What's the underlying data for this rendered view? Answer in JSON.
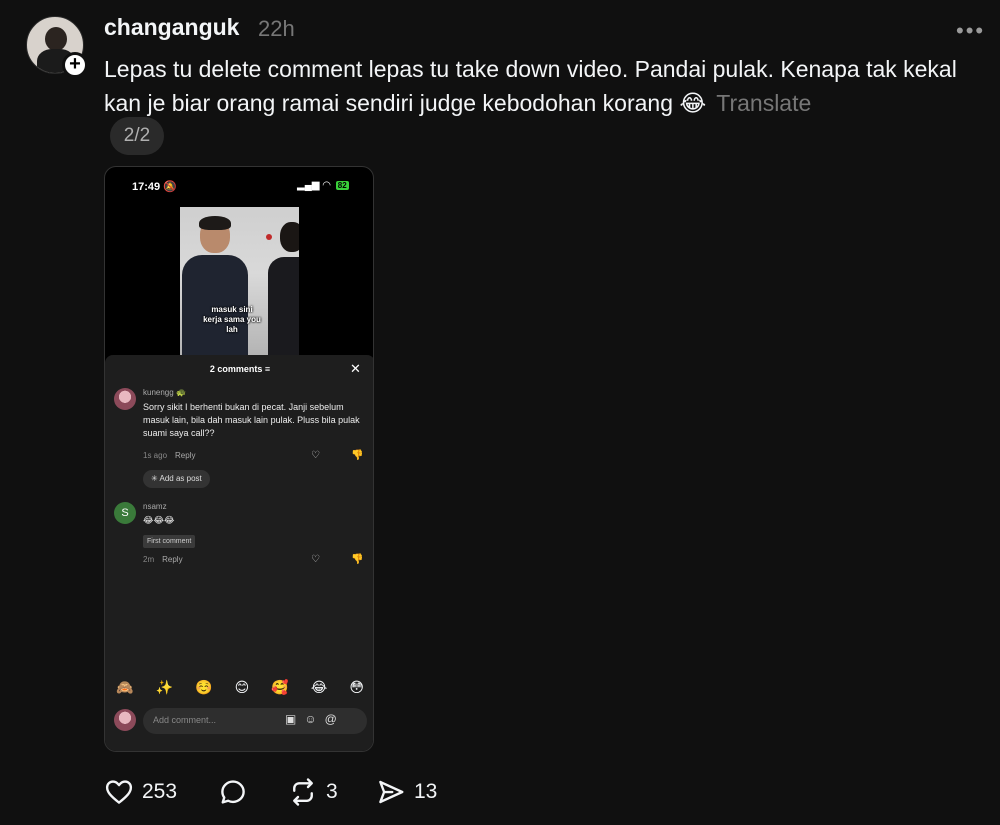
{
  "post": {
    "username": "changanguk",
    "time": "22h",
    "more": "•••",
    "text": "Lepas tu delete comment lepas tu take down video. Pandai pulak. Kenapa tak kekal kan je biar orang ramai sendiri judge kebodohan korang 😂",
    "translate": "Translate",
    "pager": "2/2"
  },
  "screenshot": {
    "status_time": "17:49",
    "status_bell": "🔕",
    "battery": "82",
    "caption": "masuk sini kerja sama you lah",
    "comments_title": "2 comments",
    "close": "✕",
    "comments": [
      {
        "user": "kunengg",
        "text": "Sorry sikit I berhenti bukan di pecat. Janji sebelum masuk lain, bila dah masuk lain pulak. Pluss bila pulak suami saya call??",
        "time": "1s ago",
        "reply": "Reply"
      },
      {
        "user": "nsamz",
        "avatar_letter": "S",
        "text": "😂😂😂",
        "tag": "First comment",
        "time": "2m",
        "reply": "Reply"
      }
    ],
    "add_as_post": "Add as post",
    "emojis": [
      "🙈",
      "✨",
      "☺️",
      "😊",
      "🥰",
      "😂",
      "😳"
    ],
    "input_placeholder": "Add comment..."
  },
  "actions": {
    "likes": "253",
    "reposts": "3",
    "shares": "13"
  }
}
